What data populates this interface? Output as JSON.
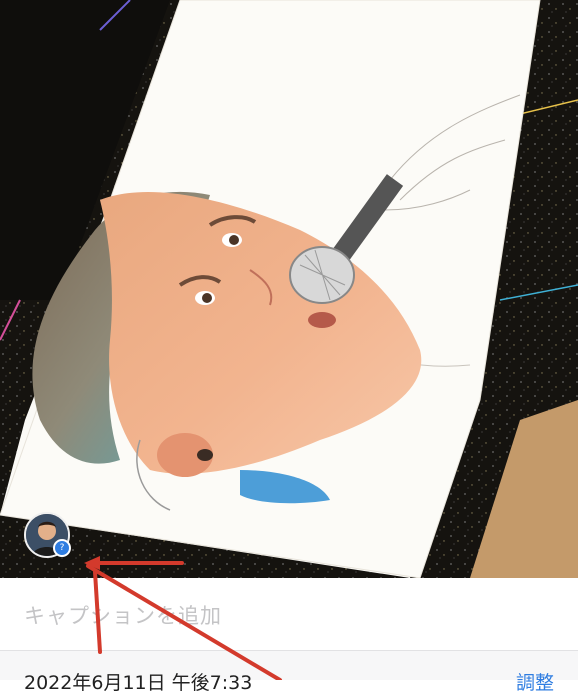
{
  "photo": {
    "description_icon": "photo-of-pencil-drawing"
  },
  "avatar": {
    "badge": "?"
  },
  "caption": {
    "placeholder": "キャプションを追加"
  },
  "meta": {
    "date": "2022年6月11日 午後7:33",
    "edit_label": "調整"
  },
  "colors": {
    "accent": "#2f7de1",
    "arrow": "#d33a2c"
  }
}
